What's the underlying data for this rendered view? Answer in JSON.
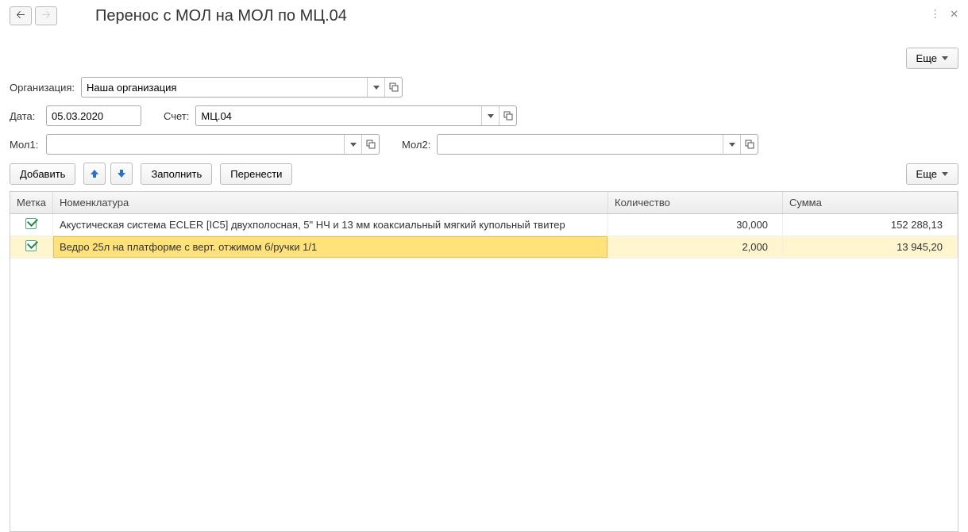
{
  "header": {
    "title": "Перенос с МОЛ на МОЛ по МЦ.04",
    "more_label": "Еще"
  },
  "form": {
    "org_label": "Организация:",
    "org_value": "Наша организация",
    "date_label": "Дата:",
    "date_value": "05.03.2020",
    "account_label": "Счет:",
    "account_value": "МЦ.04",
    "mol1_label": "Мол1:",
    "mol1_value": "",
    "mol2_label": "Мол2:",
    "mol2_value": ""
  },
  "toolbar": {
    "add_label": "Добавить",
    "fill_label": "Заполнить",
    "transfer_label": "Перенести",
    "more_label": "Еще"
  },
  "grid": {
    "headers": {
      "mark": "Метка",
      "nomenclature": "Номенклатура",
      "quantity": "Количество",
      "sum": "Сумма"
    },
    "rows": [
      {
        "checked": true,
        "name": "Акустическая система ECLER [IC5] двухполосная, 5\" НЧ и 13 мм коаксиальный мягкий купольный твитер",
        "qty": "30,000",
        "sum": "152 288,13",
        "selected": false
      },
      {
        "checked": true,
        "name": "Ведро 25л на платформе с верт. отжимом б/ручки 1/1",
        "qty": "2,000",
        "sum": "13 945,20",
        "selected": true
      }
    ]
  }
}
